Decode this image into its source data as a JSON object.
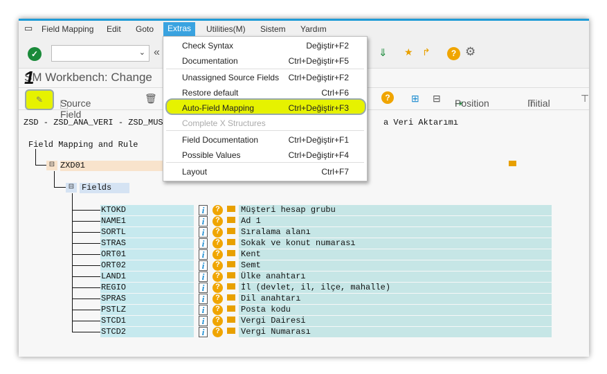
{
  "menubar": {
    "items": [
      "Field Mapping",
      "Edit",
      "Goto",
      "Extras",
      "Utilities(M)",
      "Sistem",
      "Yardım"
    ],
    "active": "Extras"
  },
  "title": "LSM Workbench: Change",
  "title_visible": "SM Workbench: Change",
  "step_badge": "1",
  "app_toolbar": {
    "source_field": "Source Field",
    "position": "Position",
    "initial": "Initial"
  },
  "extras_menu": [
    {
      "label": "Check Syntax",
      "shortcut": "Değiştir+F2"
    },
    {
      "label": "Documentation",
      "shortcut": "Ctrl+Değiştir+F5"
    },
    {
      "label": "Unassigned Source Fields",
      "shortcut": "Ctrl+Değiştir+F2"
    },
    {
      "label": "Restore default",
      "shortcut": "Ctrl+F6"
    },
    {
      "label": "Auto-Field Mapping",
      "shortcut": "Ctrl+Değiştir+F3",
      "highlighted": true
    },
    {
      "label": "Complete X Structures",
      "shortcut": "",
      "disabled": true
    },
    {
      "label": "Field Documentation",
      "shortcut": "Ctrl+Değiştir+F1"
    },
    {
      "label": "Possible Values",
      "shortcut": "Ctrl+Değiştir+F4"
    },
    {
      "label": "Layout",
      "shortcut": "Ctrl+F7"
    }
  ],
  "header_line_left": "ZSD - ZSD_ANA_VERI - ZSD_MUST",
  "header_line_right": "a Veri Aktarımı",
  "tree": {
    "root": "Field Mapping and Rule",
    "object": "ZXD01",
    "folder": "Fields"
  },
  "fields": [
    {
      "name": "KTOKD",
      "desc": "Müşteri hesap grubu"
    },
    {
      "name": "NAME1",
      "desc": "Ad 1"
    },
    {
      "name": "SORTL",
      "desc": "Sıralama alanı"
    },
    {
      "name": "STRAS",
      "desc": "Sokak ve konut numarası"
    },
    {
      "name": "ORT01",
      "desc": "Kent"
    },
    {
      "name": "ORT02",
      "desc": "Semt"
    },
    {
      "name": "LAND1",
      "desc": "Ülke anahtarı"
    },
    {
      "name": "REGIO",
      "desc": "İl (devlet, il, ilçe, mahalle)"
    },
    {
      "name": "SPRAS",
      "desc": "Dil anahtarı"
    },
    {
      "name": "PSTLZ",
      "desc": "Posta kodu"
    },
    {
      "name": "STCD1",
      "desc": "Vergi Dairesi"
    },
    {
      "name": "STCD2",
      "desc": "Vergi Numarası"
    }
  ],
  "colors": {
    "accent": "#1e9bd7",
    "highlight": "#e6f200",
    "field_bg": "#c6e9ee",
    "object_bg": "#f8e3cc",
    "folder_bg": "#d5e3f3"
  }
}
